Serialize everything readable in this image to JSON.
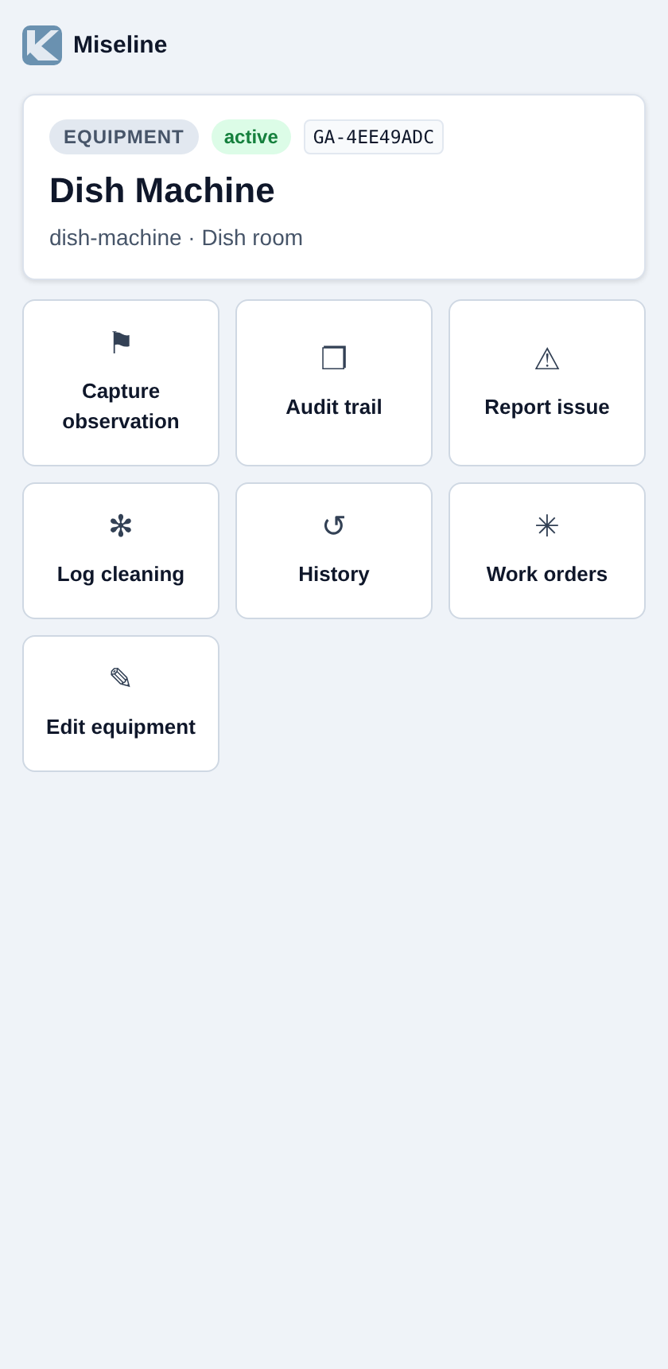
{
  "header": {
    "app_name": "Miseline"
  },
  "equipment": {
    "category": "EQUIPMENT",
    "status": "active",
    "code": "GA-4EE49ADC",
    "name": "Dish Machine",
    "slug": "dish-machine",
    "separator": "·",
    "location": "Dish room"
  },
  "actions": [
    {
      "icon": "⚑",
      "label": "Capture observation"
    },
    {
      "icon": "❐",
      "label": "Audit trail"
    },
    {
      "icon": "⚠",
      "label": "Report issue"
    },
    {
      "icon": "✻",
      "label": "Log cleaning"
    },
    {
      "icon": "↺",
      "label": "History"
    },
    {
      "icon": "✳",
      "label": "Work orders"
    },
    {
      "icon": "✎",
      "label": "Edit equipment"
    }
  ]
}
